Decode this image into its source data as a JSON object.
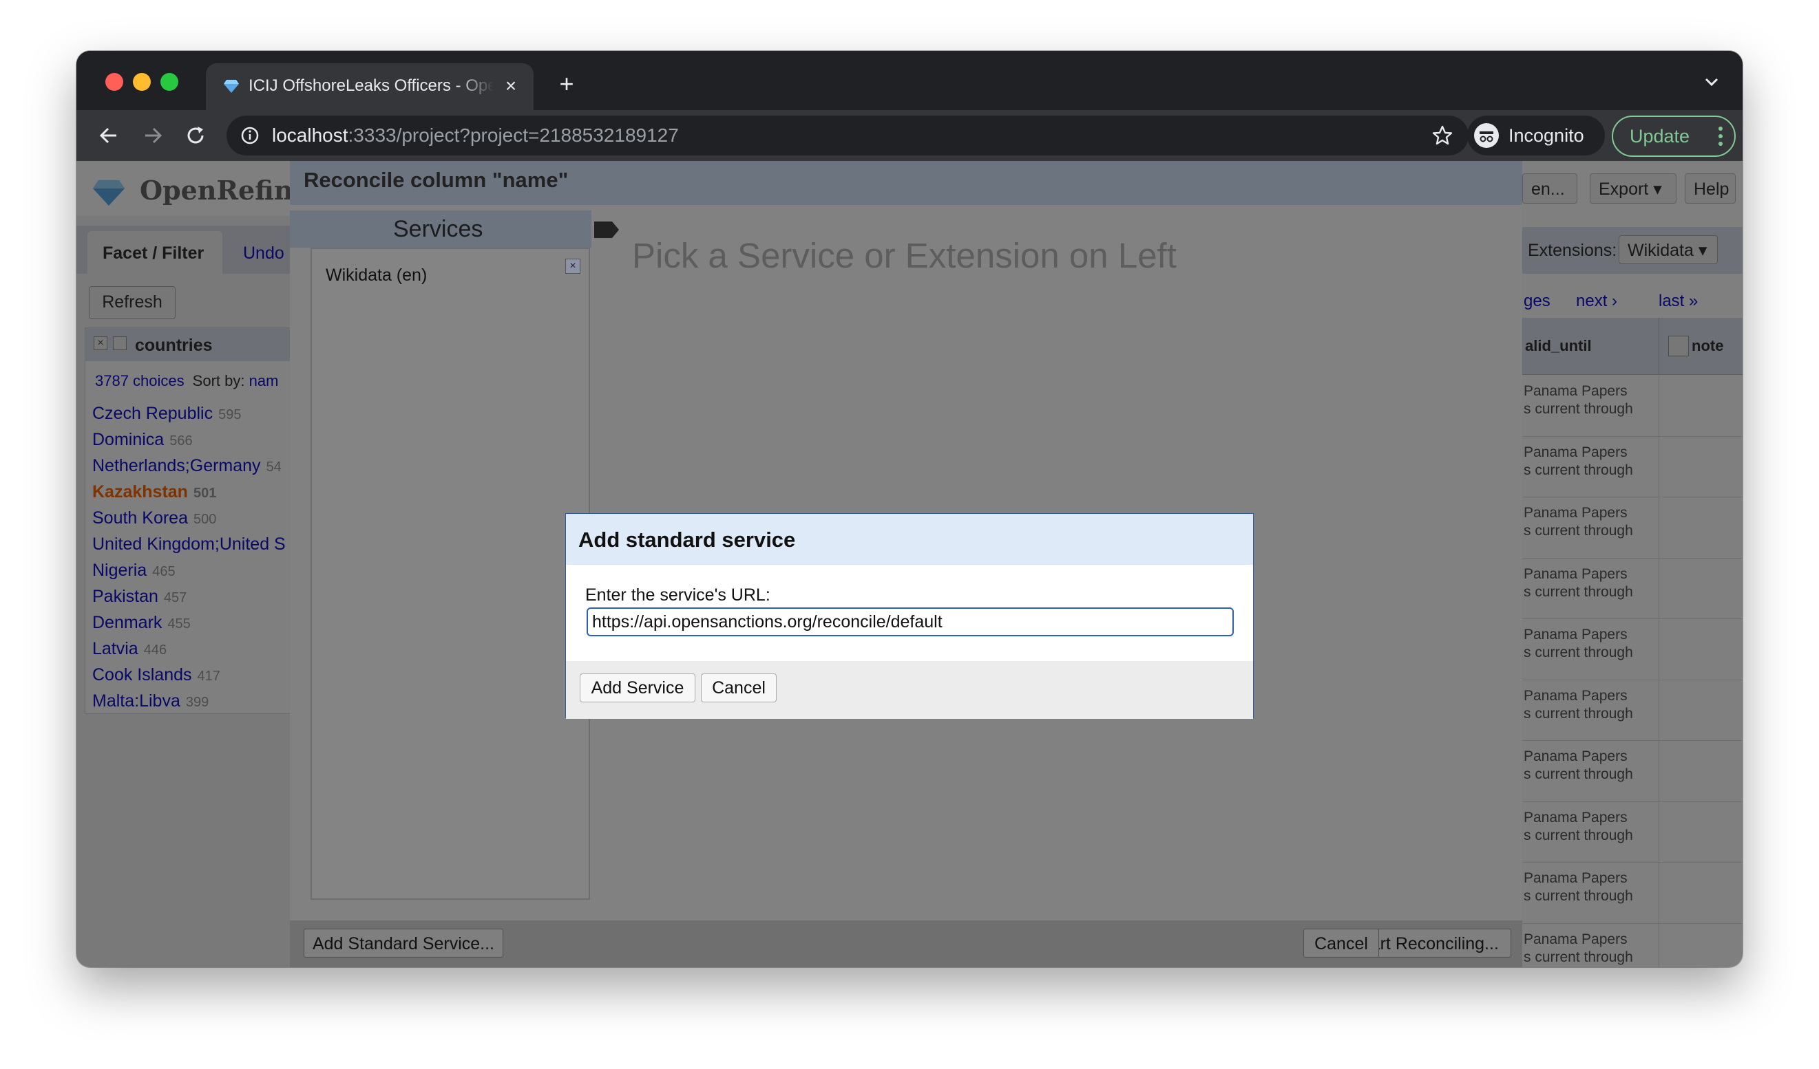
{
  "browser": {
    "tab_title": "ICIJ OffshoreLeaks Officers - OpenRefine",
    "url_host": "localhost",
    "url_rest": ":3333/project?project=2188532189127",
    "incognito_label": "Incognito",
    "update_label": "Update",
    "colors": {
      "frame": "#202124",
      "toolbar": "#35363a",
      "update": "#81c995"
    }
  },
  "openrefine": {
    "logo_text": "OpenRefine",
    "header_buttons": {
      "open": "en...",
      "export": "Export",
      "help": "Help"
    },
    "left_tabs": {
      "facet_filter": "Facet / Filter",
      "undo": "Undo"
    },
    "refresh_label": "Refresh",
    "facet": {
      "title": "countries",
      "choices_count": "3787 choices",
      "sort_by": "Sort by:",
      "sort_value": "nam",
      "items": [
        {
          "name": "Czech Republic",
          "count": "595"
        },
        {
          "name": "Dominica",
          "count": "566"
        },
        {
          "name": "Netherlands;Germany",
          "count": "54"
        },
        {
          "name": "Kazakhstan",
          "count": "501",
          "selected": true
        },
        {
          "name": "South Korea",
          "count": "500"
        },
        {
          "name": "United Kingdom;United S",
          "count": ""
        },
        {
          "name": "Nigeria",
          "count": "465"
        },
        {
          "name": "Pakistan",
          "count": "457"
        },
        {
          "name": "Denmark",
          "count": "455"
        },
        {
          "name": "Latvia",
          "count": "446"
        },
        {
          "name": "Cook Islands",
          "count": "417"
        },
        {
          "name": "Malta;Libya",
          "count": "399"
        }
      ]
    },
    "extensions_label": "Extensions:",
    "extensions_value": "Wikidata",
    "pager": {
      "pages": "ges",
      "next": "next ›",
      "last": "last »"
    },
    "columns": {
      "valid_until": "alid_until",
      "note": "note"
    },
    "row_line1": "Panama Papers",
    "row_line2": "s current through"
  },
  "reconcile_dialog": {
    "title": "Reconcile column \"name\"",
    "services_heading": "Services",
    "services": [
      "Wikidata (en)"
    ],
    "hint": "Pick a Service or Extension on Left",
    "add_standard_service_label": "Add Standard Service...",
    "start_reconciling_label": "Start Reconciling...",
    "cancel_label": "Cancel"
  },
  "add_service_modal": {
    "title": "Add standard service",
    "url_label": "Enter the service's URL:",
    "url_value": "https://api.opensanctions.org/reconcile/default",
    "add_label": "Add Service",
    "cancel_label": "Cancel"
  }
}
